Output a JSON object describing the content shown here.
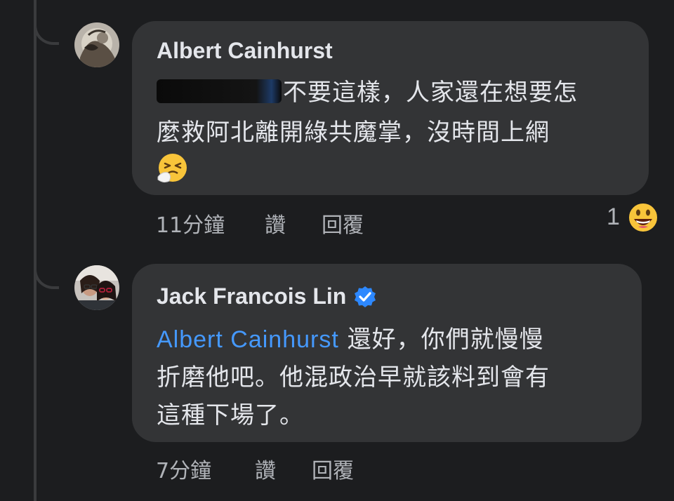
{
  "comments": [
    {
      "author": "Albert Cainhurst",
      "text_lines": [
        "不要這樣，人家還在想要怎",
        "麼救阿北離開綠共魔掌，沒時間上網"
      ],
      "emoji": "sneezing-face",
      "time": "11分鐘",
      "like_label": "讚",
      "reply_label": "回覆",
      "reaction_count": "1",
      "reaction_emoji": "grinning-face"
    },
    {
      "author": "Jack Francois Lin",
      "verified": true,
      "mention": "Albert Cainhurst",
      "text_lines": [
        "還好，你們就慢慢",
        "折磨他吧。他混政治早就該料到會有",
        "這種下場了。"
      ],
      "time": "7分鐘",
      "like_label": "讚",
      "reply_label": "回覆"
    }
  ],
  "colors": {
    "background": "#1c1d1f",
    "bubble": "#333436",
    "text": "#e4e6eb",
    "secondary_text": "#b0b3b8",
    "mention": "#4599ff",
    "verified_badge": "#2d88ff"
  }
}
